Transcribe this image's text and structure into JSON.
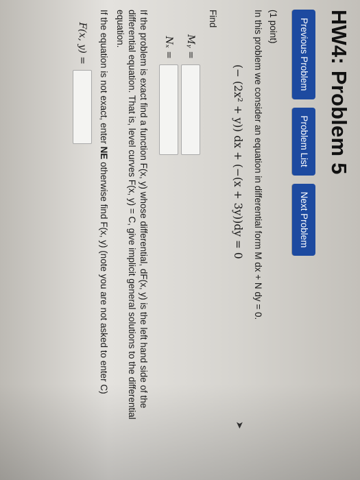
{
  "header": {
    "title": "HW4: Problem 5"
  },
  "nav": {
    "previous_label": "Previous Problem",
    "list_label": "Problem List",
    "next_label": "Next Problem"
  },
  "problem": {
    "points": "(1 point)",
    "intro": "In this problem we consider an equation in differential form M dx + N dy = 0.",
    "equation": "(− (2x² + y)) dx + (−(x + 3y))dy = 0",
    "find_label": "Find",
    "my_label": "Mᵧ =",
    "nx_label": "Nₓ =",
    "exact_line1": "If the problem is exact find a function F(x, y) whose differential, dF(x, y) is the left hand side of the",
    "exact_line2": "differential equation. That is, level curves F(x, y) = C, give implicit general solutions to the differential",
    "exact_line3": "equation.",
    "ne_prefix": "If the equation is not exact, enter ",
    "ne_bold": "NE",
    "ne_suffix": " otherwise find F(x, y) (note you are not asked to enter C)",
    "f_label": "F(x, y) ="
  },
  "colors": {
    "nav_button": "#1d4aa0",
    "background": "#e4e2de"
  }
}
